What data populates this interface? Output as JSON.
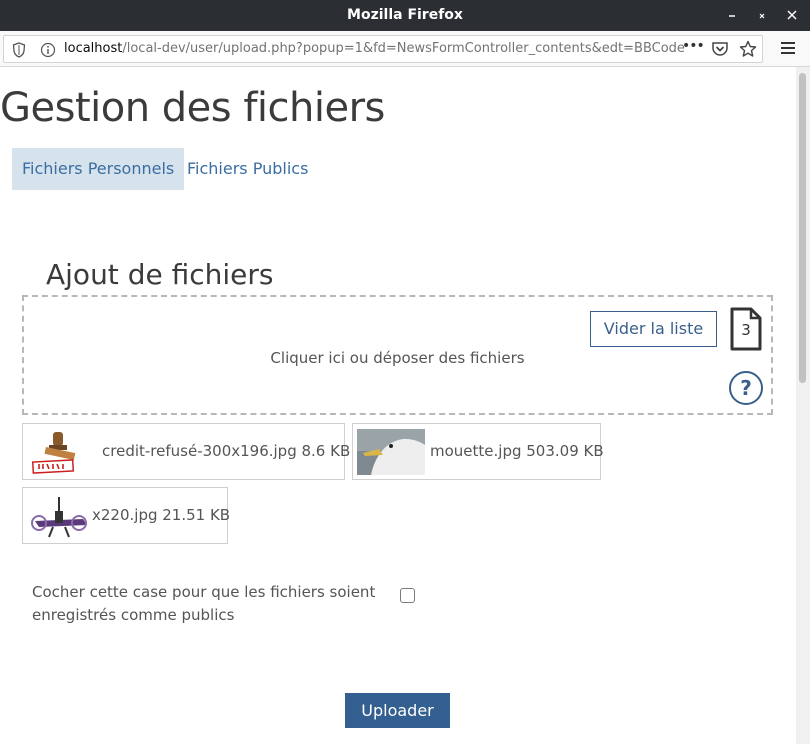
{
  "window": {
    "title": "Mozilla Firefox"
  },
  "urlbar": {
    "host": "localhost",
    "path": "/local-dev/user/upload.php?popup=1&fd=NewsFormController_contents&edt=BBCode",
    "more_label": "•••"
  },
  "page": {
    "title": "Gestion des fichiers",
    "tabs": [
      {
        "label": "Fichiers Personnels",
        "active": true
      },
      {
        "label": "Fichiers Publics",
        "active": false
      }
    ]
  },
  "upload": {
    "section_title": "Ajout de fichiers",
    "dropzone_text": "Cliquer ici ou déposer des fichiers",
    "clear_label": "Vider la liste",
    "file_count": "3",
    "help_label": "?",
    "files": [
      {
        "label": "credit-refusé-300x196.jpg 8.6 KB",
        "thumb": "stamp-refuse"
      },
      {
        "label": "mouette.jpg 503.09 KB",
        "thumb": "seagull"
      },
      {
        "label": "x220.jpg 21.51 KB",
        "thumb": "drone"
      }
    ],
    "public_label": "Cocher cette case pour que les fichiers soient enregistrés comme publics",
    "public_checked": false,
    "submit_label": "Uploader"
  },
  "colors": {
    "accent": "#346091",
    "tab_active_bg": "#d7e3ec",
    "titlebar": "#2b2e33"
  }
}
